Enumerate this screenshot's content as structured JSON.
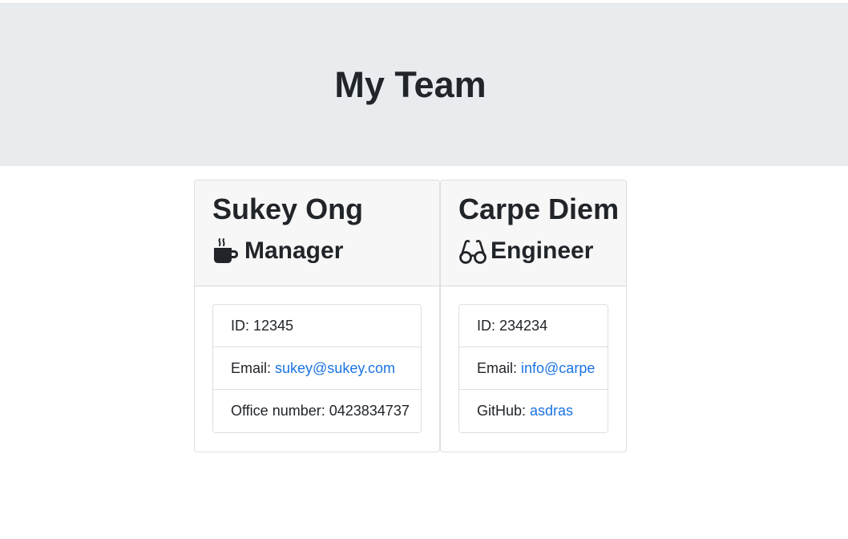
{
  "header": {
    "title": "My Team"
  },
  "employees": [
    {
      "name": "Sukey Ong",
      "role": "Manager",
      "role_icon": "coffee-mug-icon",
      "id_label": "ID: ",
      "id": "12345",
      "email_label": "Email: ",
      "email": "sukey@sukey.com",
      "extra_label": "Office number: ",
      "extra_value": "0423834737"
    },
    {
      "name": "Carpe Diem",
      "role": "Engineer",
      "role_icon": "glasses-icon",
      "id_label": "ID: ",
      "id": "234234",
      "email_label": "Email: ",
      "email": "info@carpe",
      "extra_label": "GitHub: ",
      "extra_value": "asdras"
    }
  ],
  "colors": {
    "jumbotron_bg": "#e9ecef",
    "card_header_bg": "#f7f7f7",
    "link": "#1b74e4",
    "text": "#212529"
  }
}
